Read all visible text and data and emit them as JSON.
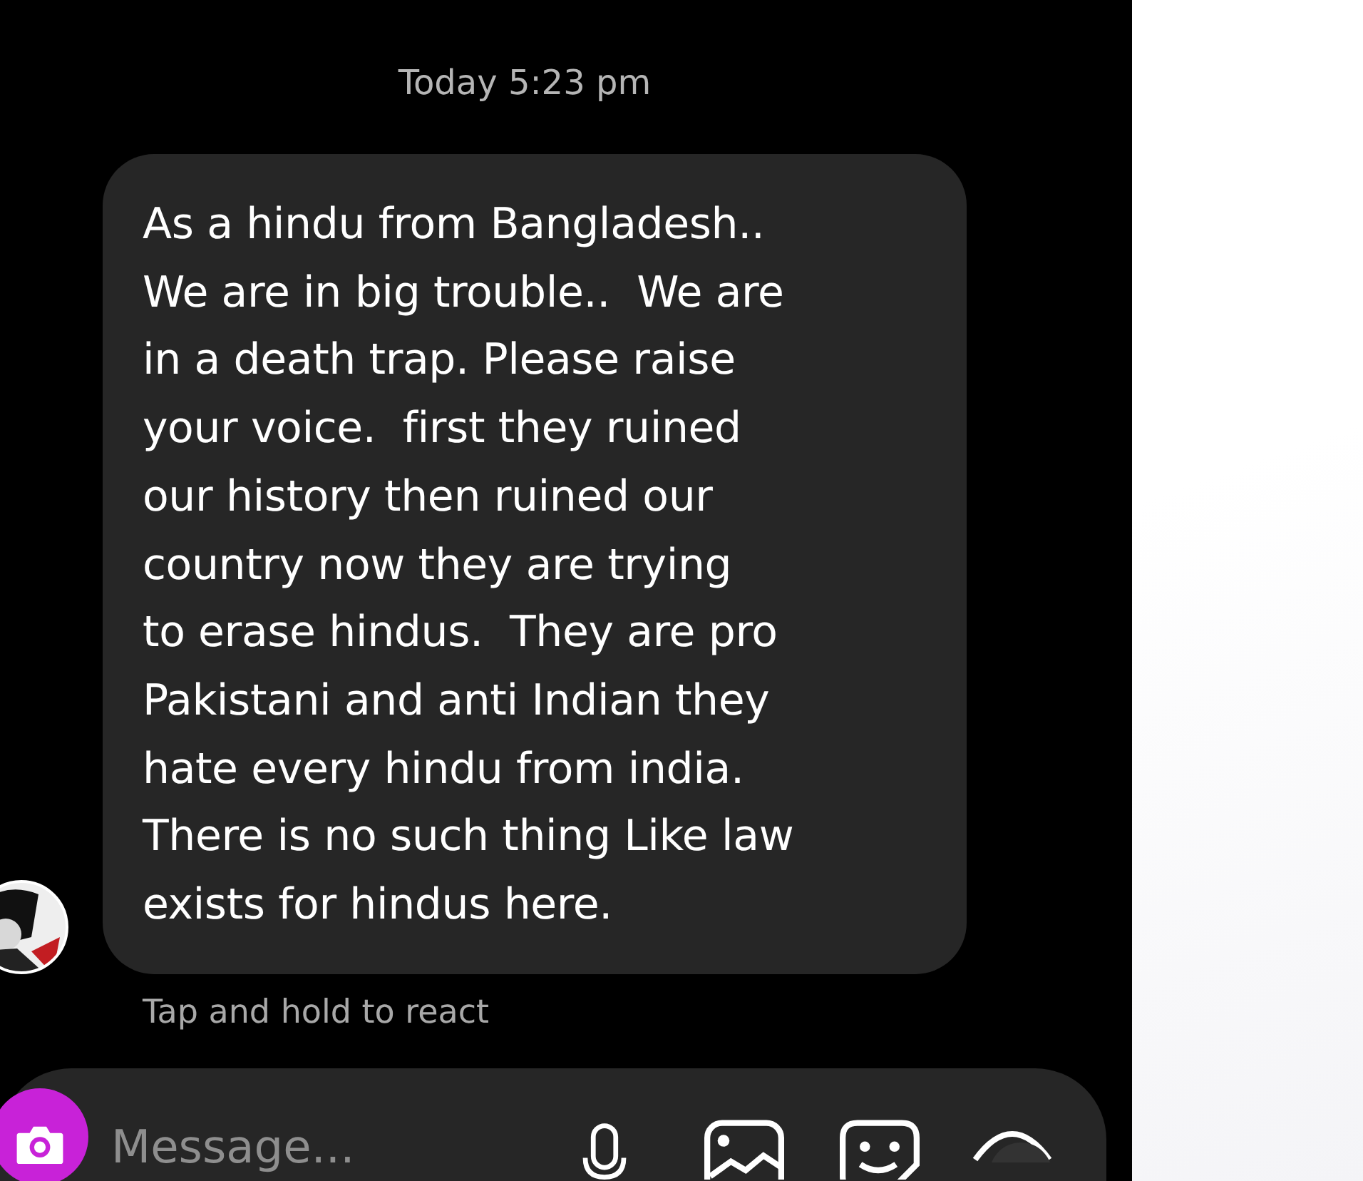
{
  "timestamp": "Today 5:23 pm",
  "message": {
    "text": "As a hindu from Bangladesh..\nWe are in big trouble..  We are\nin a death trap. Please raise\nyour voice.  first they ruined\nour history then ruined our\ncountry now they are trying\nto erase hindus.  They are pro\nPakistani and anti Indian they\nhate every hindu from india.\nThere is no such thing Like law\nexists for hindus here.",
    "hint": "Tap and hold to react"
  },
  "composer": {
    "placeholder": "Message..."
  }
}
